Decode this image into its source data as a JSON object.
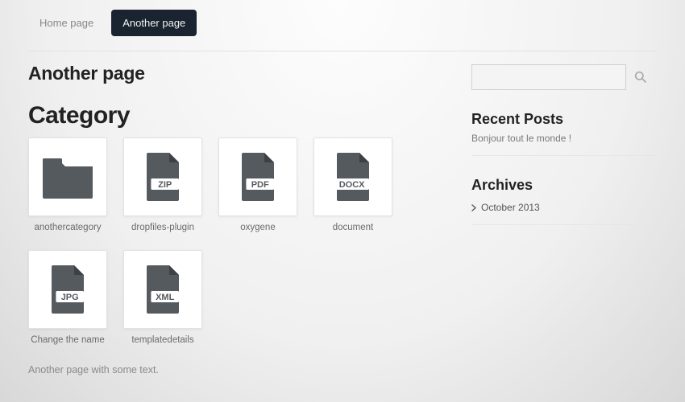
{
  "nav": [
    {
      "label": "Home page",
      "active": false
    },
    {
      "label": "Another page",
      "active": true
    }
  ],
  "page_title": "Another page",
  "category_title": "Category",
  "files": [
    {
      "type": "folder",
      "label": "anothercategory"
    },
    {
      "type": "zip",
      "label": "dropfiles-plugin"
    },
    {
      "type": "pdf",
      "label": "oxygene"
    },
    {
      "type": "docx",
      "label": "document"
    },
    {
      "type": "jpg",
      "label": "Change the name"
    },
    {
      "type": "xml",
      "label": "templatedetails"
    }
  ],
  "body_text": "Another page with some text.",
  "sidebar": {
    "search_placeholder": "",
    "recent_heading": "Recent Posts",
    "recent_post": "Bonjour tout le monde !",
    "archives_heading": "Archives",
    "archive_item": "October 2013"
  }
}
